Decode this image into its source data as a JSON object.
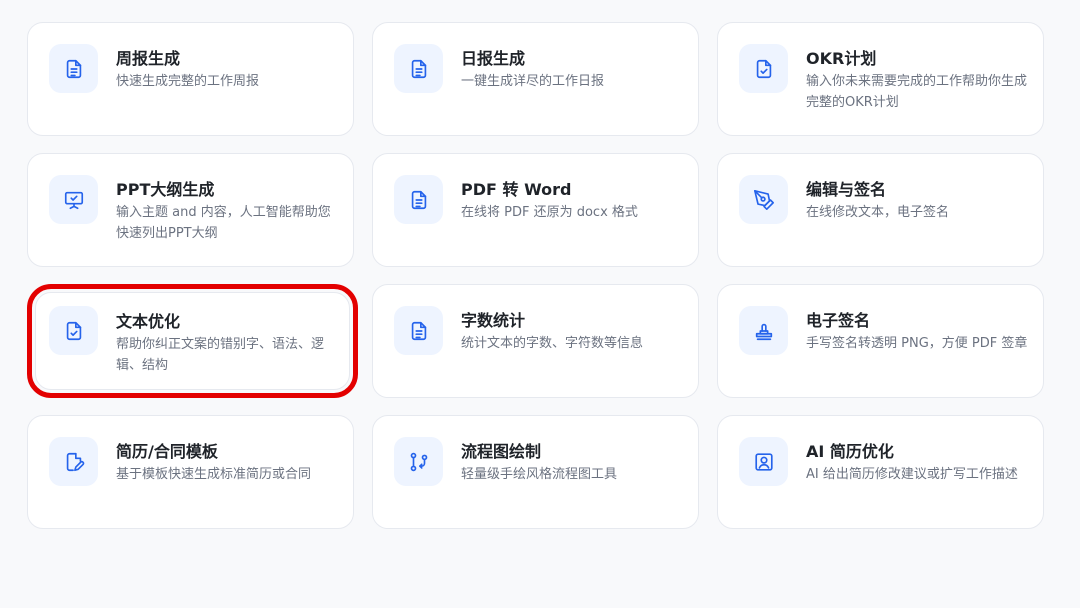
{
  "accent_color": "#2563eb",
  "highlight_color": "#e30000",
  "tools": [
    {
      "name": "weekly-report",
      "icon": "document-icon",
      "title": "周报生成",
      "desc": "快速生成完整的工作周报"
    },
    {
      "name": "daily-report",
      "icon": "document-icon",
      "title": "日报生成",
      "desc": "一键生成详尽的工作日报"
    },
    {
      "name": "okr-plan",
      "icon": "document-check-icon",
      "title": "OKR计划",
      "desc": "输入你未来需要完成的工作帮助你生成完整的OKR计划"
    },
    {
      "name": "ppt-outline",
      "icon": "presentation-icon",
      "title": "PPT大纲生成",
      "desc": "输入主题 and 内容，人工智能帮助您快速列出PPT大纲"
    },
    {
      "name": "pdf-to-word",
      "icon": "document-icon",
      "title": "PDF 转 Word",
      "desc": "在线将 PDF 还原为 docx 格式"
    },
    {
      "name": "edit-sign",
      "icon": "pen-nib-icon",
      "title": "编辑与签名",
      "desc": "在线修改文本，电子签名"
    },
    {
      "name": "text-optimize",
      "icon": "document-check-icon",
      "title": "文本优化",
      "desc": "帮助你纠正文案的错别字、语法、逻辑、结构",
      "selected": true
    },
    {
      "name": "word-count",
      "icon": "document-icon",
      "title": "字数统计",
      "desc": "统计文本的字数、字符数等信息"
    },
    {
      "name": "e-signature",
      "icon": "stamp-icon",
      "title": "电子签名",
      "desc": "手写签名转透明 PNG，方便 PDF 签章"
    },
    {
      "name": "resume-contract-template",
      "icon": "document-edit-icon",
      "title": "简历/合同模板",
      "desc": "基于模板快速生成标准简历或合同"
    },
    {
      "name": "flowchart",
      "icon": "flowchart-icon",
      "title": "流程图绘制",
      "desc": "轻量级手绘风格流程图工具"
    },
    {
      "name": "ai-resume-optimize",
      "icon": "profile-icon",
      "title": "AI 简历优化",
      "desc": "AI 给出简历修改建议或扩写工作描述"
    }
  ]
}
